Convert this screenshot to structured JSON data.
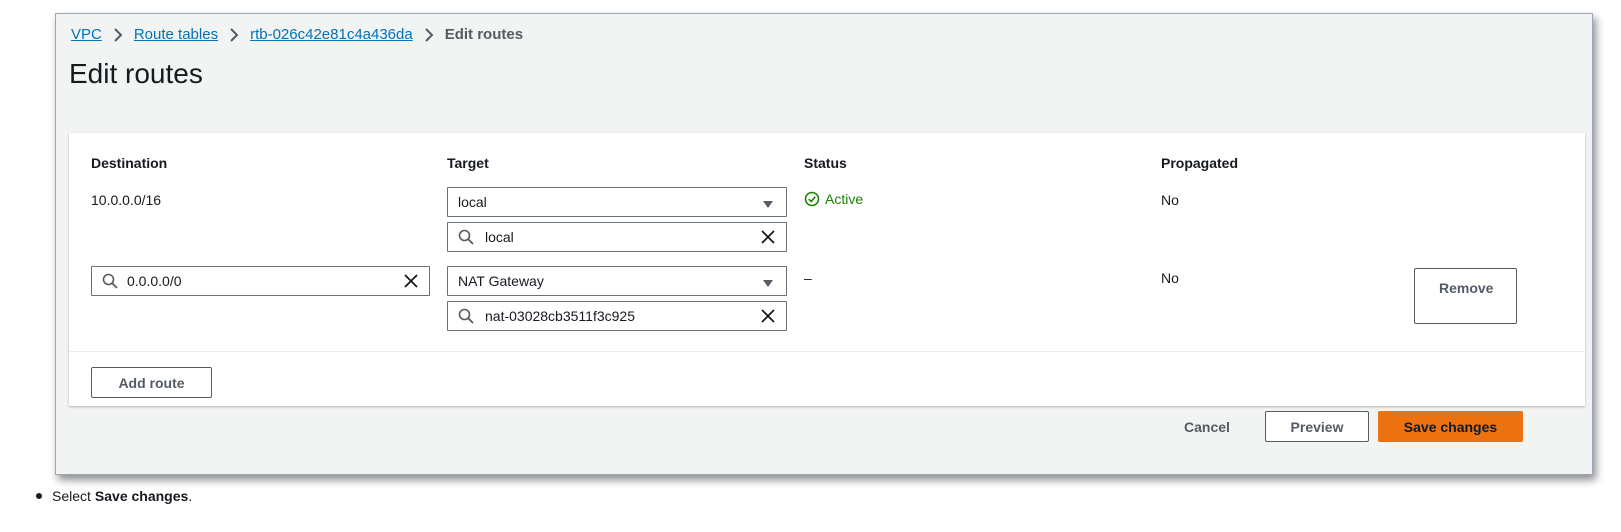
{
  "breadcrumb": {
    "items": [
      "VPC",
      "Route tables",
      "rtb-026c42e81c4a436da"
    ],
    "current": "Edit routes"
  },
  "page": {
    "title": "Edit routes"
  },
  "table": {
    "headers": {
      "destination": "Destination",
      "target": "Target",
      "status": "Status",
      "propagated": "Propagated"
    },
    "rows": [
      {
        "destination": "10.0.0.0/16",
        "target_type": "local",
        "target_value": "local",
        "status": "Active",
        "propagated": "No"
      },
      {
        "destination": "0.0.0.0/0",
        "target_type": "NAT Gateway",
        "target_value": "nat-03028cb3511f3c925",
        "status": "–",
        "propagated": "No",
        "remove_label": "Remove"
      }
    ]
  },
  "actions": {
    "add_route": "Add route",
    "cancel": "Cancel",
    "preview": "Preview",
    "save": "Save changes"
  },
  "instruction": {
    "prefix": "Select",
    "emphasis": "Save changes",
    "suffix": "."
  },
  "colors": {
    "link": "#0073bb",
    "primary": "#ec7211",
    "success": "#1d8102"
  },
  "icons": [
    "chevron-right-icon",
    "caret-down-icon",
    "search-icon",
    "clear-icon",
    "check-circle-icon"
  ]
}
